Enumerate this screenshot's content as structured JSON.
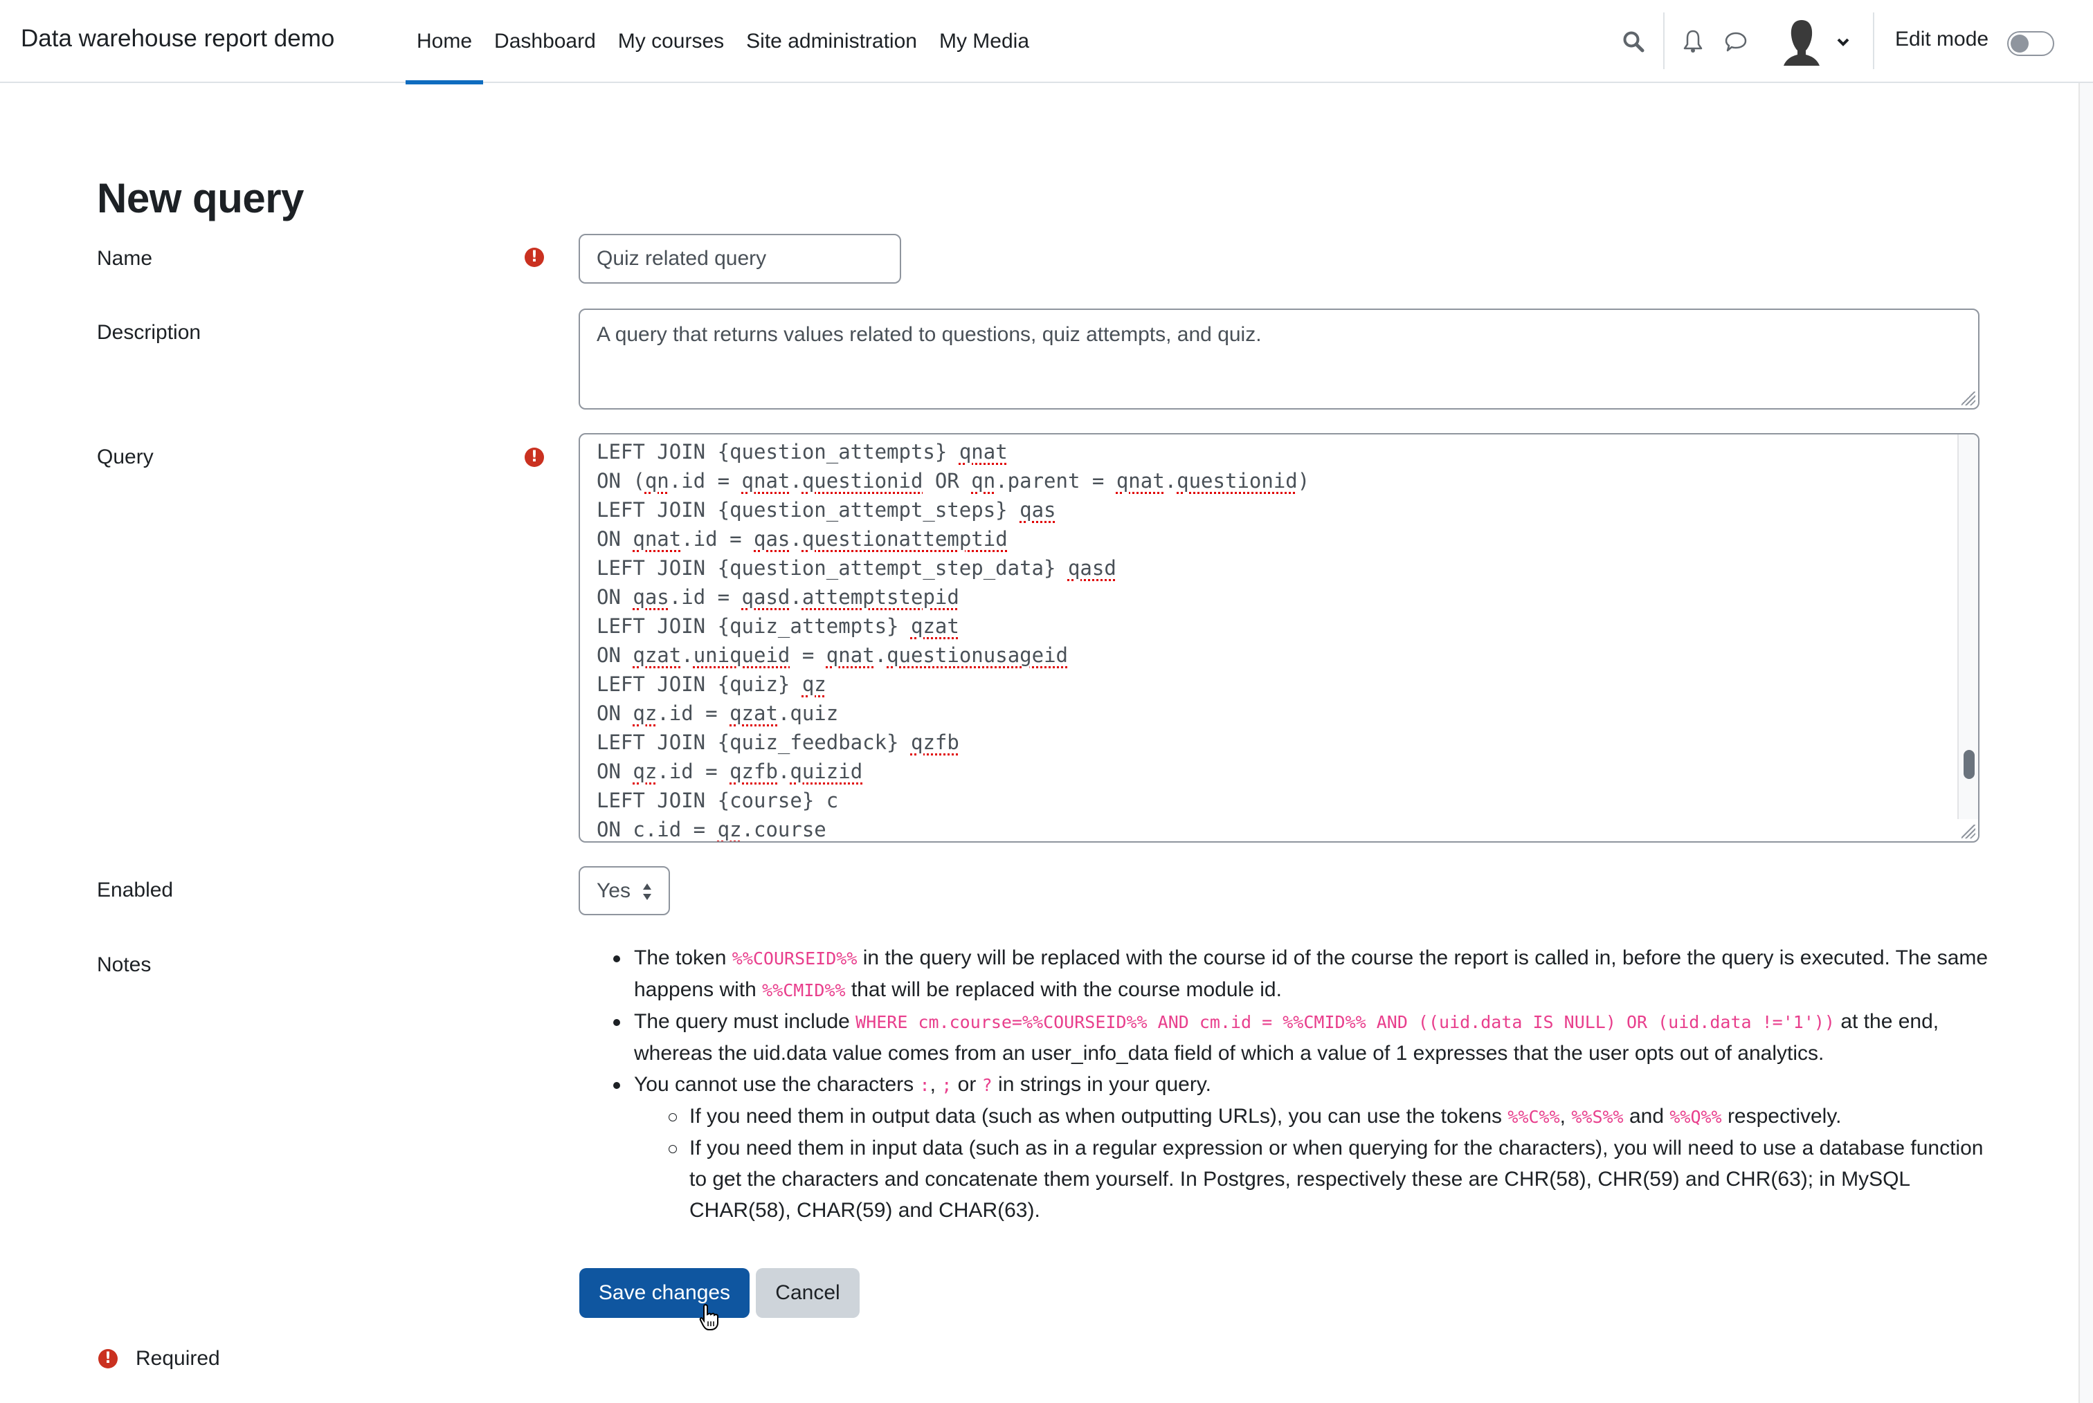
{
  "header": {
    "brand": "Data warehouse report demo",
    "nav": [
      {
        "label": "Home",
        "active": true
      },
      {
        "label": "Dashboard",
        "active": false
      },
      {
        "label": "My courses",
        "active": false
      },
      {
        "label": "Site administration",
        "active": false
      },
      {
        "label": "My Media",
        "active": false
      }
    ],
    "icons": [
      "search-icon",
      "bell-icon",
      "message-icon",
      "avatar",
      "chevron-down-icon"
    ],
    "edit_mode_label": "Edit mode",
    "edit_mode_on": false
  },
  "page": {
    "title": "New query"
  },
  "form": {
    "name": {
      "label": "Name",
      "value": "Quiz related query",
      "required": true
    },
    "description": {
      "label": "Description",
      "value": "A query that returns values related to questions, quiz attempts, and quiz."
    },
    "query": {
      "label": "Query",
      "required": true,
      "visible_lines": [
        "LEFT JOIN {question_attempts} qnat",
        "ON (qn.id = qnat.questionid OR qn.parent = qnat.questionid)",
        "LEFT JOIN {question_attempt_steps} qas",
        "ON qnat.id = qas.questionattemptid",
        "LEFT JOIN {question_attempt_step_data} qasd",
        "ON qas.id = qasd.attemptstepid",
        "LEFT JOIN {quiz_attempts} qzat",
        "ON qzat.uniqueid = qnat.questionusageid",
        "LEFT JOIN {quiz} qz",
        "ON qz.id = qzat.quiz",
        "LEFT JOIN {quiz_feedback} qzfb",
        "ON qz.id = qzfb.quizid",
        "LEFT JOIN {course} c",
        "ON c.id = qz.course"
      ]
    },
    "enabled": {
      "label": "Enabled",
      "value": "Yes"
    },
    "notes": {
      "label": "Notes",
      "items": [
        {
          "parts": [
            {
              "t": "The token "
            },
            {
              "c": "%%COURSEID%%"
            },
            {
              "t": " in the query will be replaced with the course id of the course the report is called in, before the query is executed. The same happens with "
            },
            {
              "c": "%%CMID%%"
            },
            {
              "t": " that will be replaced with the course module id."
            }
          ]
        },
        {
          "parts": [
            {
              "t": "The query must include "
            },
            {
              "c": "WHERE cm.course=%%COURSEID%% AND cm.id = %%CMID%% AND ((uid.data IS NULL) OR (uid.data !='1'))"
            },
            {
              "t": " at the end, whereas the uid.data value comes from an user_info_data field of which a value of 1 expresses that the user opts out of analytics."
            }
          ]
        },
        {
          "parts": [
            {
              "t": "You cannot use the characters "
            },
            {
              "c": ":"
            },
            {
              "t": ", "
            },
            {
              "c": ";"
            },
            {
              "t": " or "
            },
            {
              "c": "?"
            },
            {
              "t": " in strings in your query."
            }
          ],
          "sub": [
            {
              "parts": [
                {
                  "t": "If you need them in output data (such as when outputting URLs), you can use the tokens "
                },
                {
                  "c": "%%C%%"
                },
                {
                  "t": ", "
                },
                {
                  "c": "%%S%%"
                },
                {
                  "t": " and "
                },
                {
                  "c": "%%Q%%"
                },
                {
                  "t": " respectively."
                }
              ]
            },
            {
              "parts": [
                {
                  "t": "If you need them in input data (such as in a regular expression or when querying for the characters), you will need to use a database function to get the characters and concatenate them yourself. In Postgres, respectively these are CHR(58), CHR(59) and CHR(63); in MySQL CHAR(58), CHAR(59) and CHAR(63)."
                }
              ]
            }
          ]
        }
      ]
    },
    "buttons": {
      "save": "Save changes",
      "cancel": "Cancel"
    },
    "required_legend": "Required"
  },
  "colors": {
    "primary": "#0f56a0",
    "nav_active": "#0f6cbf",
    "required": "#ca3120",
    "code": "#e83e8c",
    "secondary_button": "#ced4da"
  }
}
